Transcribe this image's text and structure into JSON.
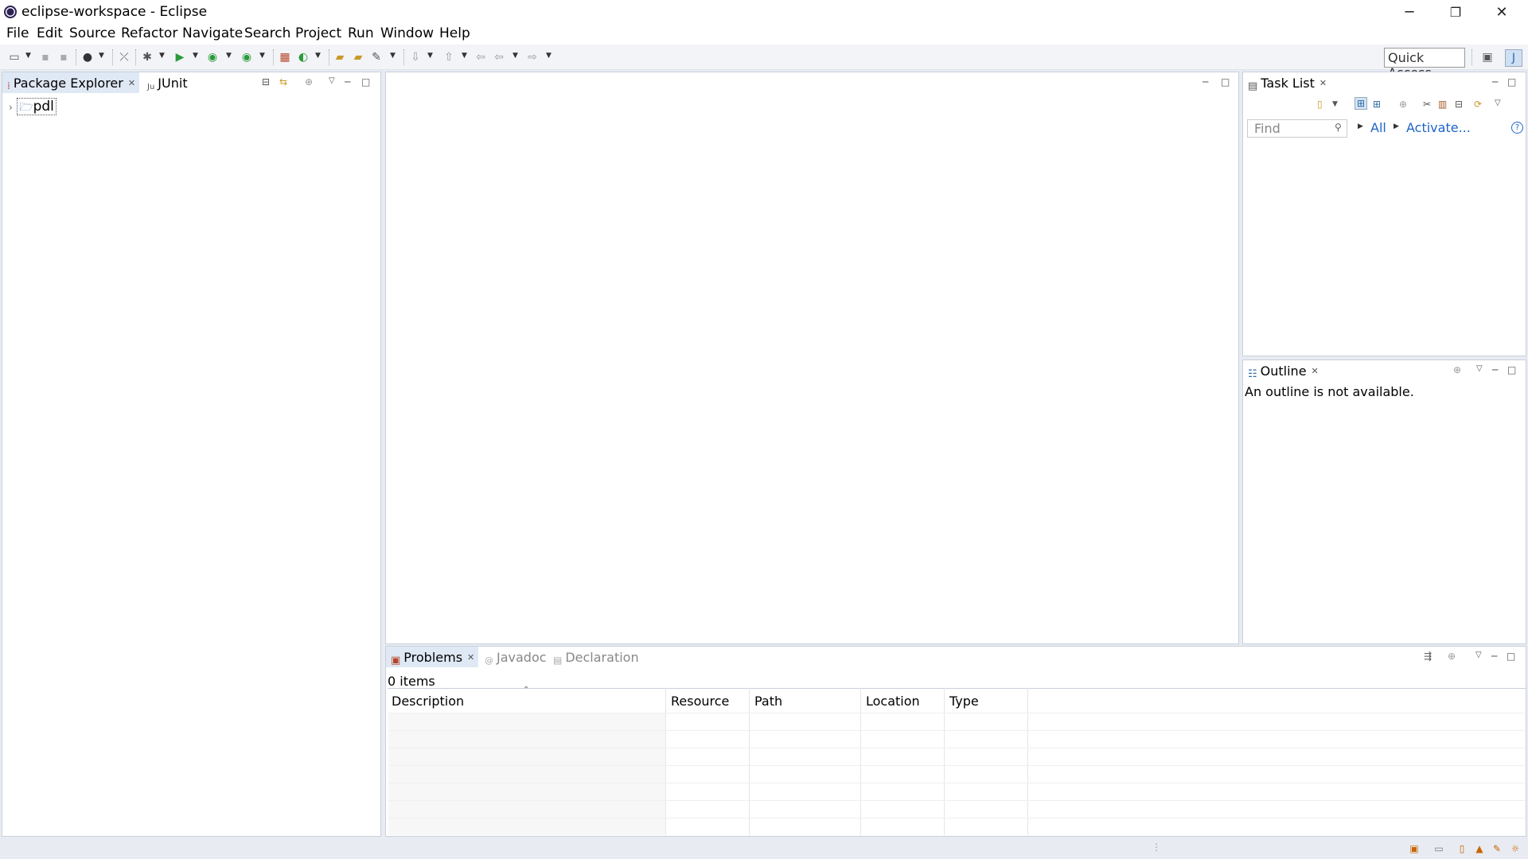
{
  "window": {
    "title": "eclipse-workspace - Eclipse",
    "minimize": "─",
    "restore": "❐",
    "close": "✕"
  },
  "menu": [
    "File",
    "Edit",
    "Source",
    "Refactor",
    "Navigate",
    "Search",
    "Project",
    "Run",
    "Window",
    "Help"
  ],
  "toolbar": {
    "quick_access": "Quick Access"
  },
  "package_explorer": {
    "tabs": [
      {
        "label": "Package Explorer"
      },
      {
        "label": "JUnit"
      }
    ],
    "tree": [
      {
        "label": "pdl",
        "expander": "›"
      }
    ]
  },
  "task_list": {
    "tab_label": "Task List",
    "find_placeholder": "Find",
    "all_label": "All",
    "activate_label": "Activate..."
  },
  "outline": {
    "tab_label": "Outline",
    "message": "An outline is not available."
  },
  "problems": {
    "tabs": [
      {
        "label": "Problems"
      },
      {
        "label": "Javadoc"
      },
      {
        "label": "Declaration"
      }
    ],
    "count": "0 items",
    "columns": [
      "Description",
      "Resource",
      "Path",
      "Location",
      "Type"
    ]
  },
  "colors": {
    "active_tab": "#dfe8f5",
    "link": "#1e64c8",
    "chrome": "#e8ecf2"
  }
}
